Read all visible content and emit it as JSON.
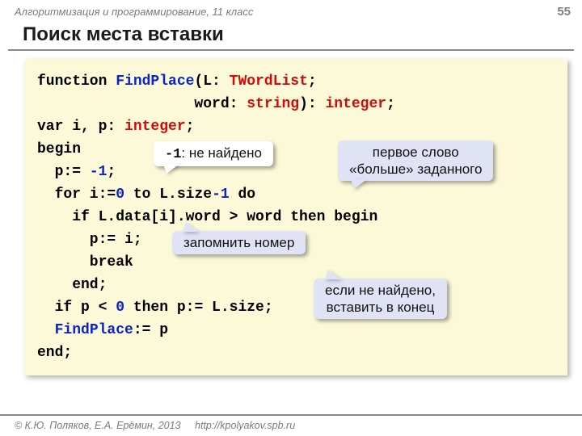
{
  "header": {
    "subject": "Алгоритмизация и программирование, 11 класс",
    "page": "55"
  },
  "title": "Поиск места вставки",
  "code": {
    "l1a": "function ",
    "l1b": "FindPlace",
    "l1c": "(L: ",
    "l1d": "TWordList",
    "l1e": ";",
    "l2a": "                  word: ",
    "l2b": "string",
    "l2c": "): ",
    "l2d": "integer",
    "l2e": ";",
    "l3a": "var i, p: ",
    "l3b": "integer",
    "l3c": ";",
    "l4": "begin",
    "l5a": "  p:= ",
    "l5b": "-1",
    "l5c": ";",
    "l6a": "  for i:=",
    "l6b": "0",
    "l6c": " to L.size",
    "l6d": "-1",
    "l6e": " do",
    "l7": "    if L.data[i].word > word then begin",
    "l8": "      p:= i;",
    "l9": "      break",
    "l10": "    end;",
    "l11a": "  if p < ",
    "l11b": "0",
    "l11c": " then p:= L.size;",
    "l12a": "  ",
    "l12b": "FindPlace",
    "l12c": ":= p",
    "l13": "end;"
  },
  "callouts": {
    "c1_mono": "-1",
    "c1_text": ": не найдено",
    "c2_l1": "первое слово",
    "c2_l2": "«больше» заданного",
    "c3": "запомнить номер",
    "c4_l1": "если не найдено,",
    "c4_l2": "вставить в  конец"
  },
  "footer": {
    "copyright": "© К.Ю. Поляков, Е.А. Ерёмин, 2013",
    "url": "http://kpolyakov.spb.ru"
  }
}
